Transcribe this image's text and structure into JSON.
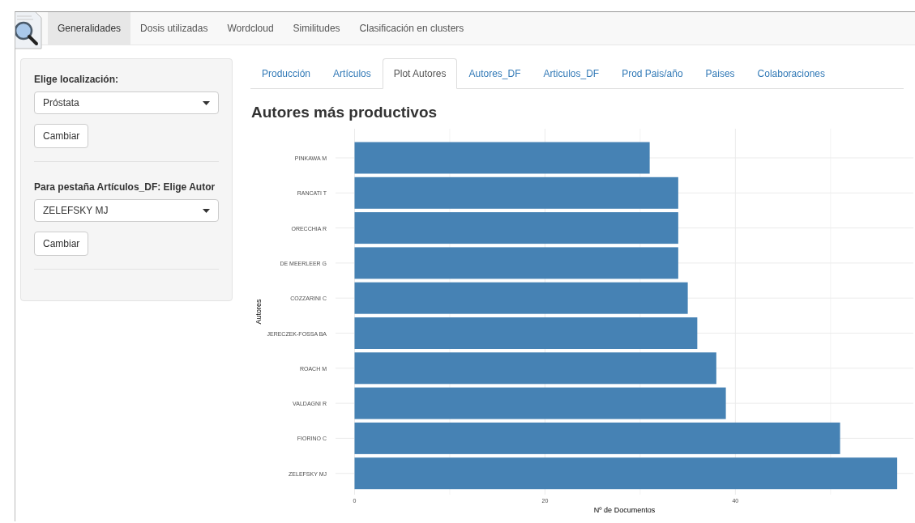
{
  "navbar": {
    "tabs": [
      {
        "label": "Generalidades",
        "selected": true
      },
      {
        "label": "Dosis utilizadas",
        "selected": false
      },
      {
        "label": "Wordcloud",
        "selected": false
      },
      {
        "label": "Similitudes",
        "selected": false
      },
      {
        "label": "Clasificación en clusters",
        "selected": false
      }
    ]
  },
  "sidebar": {
    "groups": [
      {
        "label": "Elige localización:",
        "value": "Próstata",
        "button": "Cambiar"
      },
      {
        "label": "Para pestaña Artículos_DF: Elige Autor",
        "value": "ZELEFSKY MJ",
        "button": "Cambiar"
      }
    ]
  },
  "tabs": [
    {
      "label": "Producción",
      "selected": false
    },
    {
      "label": "Artículos",
      "selected": false
    },
    {
      "label": "Plot Autores",
      "selected": true
    },
    {
      "label": "Autores_DF",
      "selected": false
    },
    {
      "label": "Articulos_DF",
      "selected": false
    },
    {
      "label": "Prod Pais/año",
      "selected": false
    },
    {
      "label": "Paises",
      "selected": false
    },
    {
      "label": "Colaboraciones",
      "selected": false
    }
  ],
  "heading": "Autores más productivos",
  "chart_data": {
    "type": "bar",
    "orientation": "horizontal",
    "ylabel": "Autores",
    "xlabel": "Nº de Documentos",
    "categories": [
      "PINKAWA M",
      "RANCATI T",
      "ORECCHIA R",
      "DE MEERLEER G",
      "COZZARINI C",
      "JERECZEK-FOSSA BA",
      "ROACH M",
      "VALDAGNI R",
      "FIORINO C",
      "ZELEFSKY MJ"
    ],
    "series": [
      {
        "color": "#4682b4",
        "values": [
          31,
          34,
          34,
          34,
          35,
          36,
          38,
          39,
          51,
          57
        ]
      }
    ],
    "xlim": [
      -2,
      58.7
    ],
    "xticks": [
      0,
      20,
      40
    ],
    "ref_lines": [
      {
        "axis": "x",
        "value": 10
      },
      {
        "axis": "x",
        "value": 30
      },
      {
        "axis": "x",
        "value": 50
      }
    ],
    "grid": true
  }
}
